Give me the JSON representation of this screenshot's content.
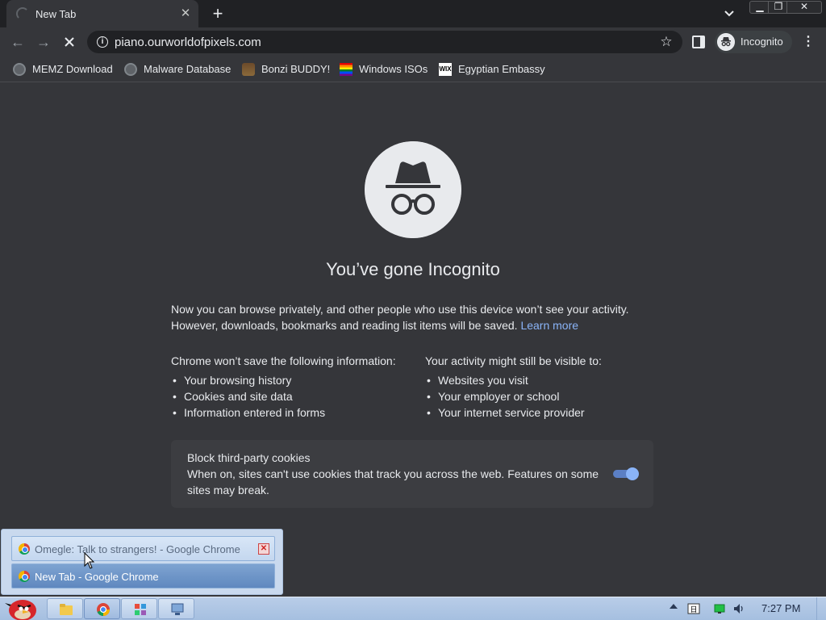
{
  "browser": {
    "tab_title": "New Tab",
    "url": "piano.ourworldofpixels.com",
    "profile_label": "Incognito"
  },
  "bookmarks": [
    {
      "label": "MEMZ Download",
      "icon": "globe-icon"
    },
    {
      "label": "Malware Database",
      "icon": "globe-icon"
    },
    {
      "label": "Bonzi BUDDY!",
      "icon": "bonzi-icon"
    },
    {
      "label": "Windows ISOs",
      "icon": "rainbow-flag-icon"
    },
    {
      "label": "Egyptian Embassy",
      "icon": "wix-icon"
    }
  ],
  "incognito": {
    "heading": "You’ve gone Incognito",
    "intro": "Now you can browse privately, and other people who use this device won’t see your activity. However, downloads, bookmarks and reading list items will be saved.",
    "learn_more": "Learn more",
    "not_saved_title": "Chrome won’t save the following information:",
    "not_saved_items": [
      "Your browsing history",
      "Cookies and site data",
      "Information entered in forms"
    ],
    "visible_title": "Your activity might still be visible to:",
    "visible_items": [
      "Websites you visit",
      "Your employer or school",
      "Your internet service provider"
    ],
    "cookie_title": "Block third-party cookies",
    "cookie_desc": "When on, sites can't use cookies that track you across the web. Features on some sites may break.",
    "cookie_toggle_on": true
  },
  "taskbar": {
    "previews": [
      {
        "label": "Omegle: Talk to strangers! - Google Chrome"
      },
      {
        "label": "New Tab - Google Chrome"
      }
    ],
    "clock": "7:27 PM"
  },
  "colors": {
    "accent": "#8ab4f8",
    "page_bg": "#35363a",
    "tabstrip_bg": "#202124"
  }
}
